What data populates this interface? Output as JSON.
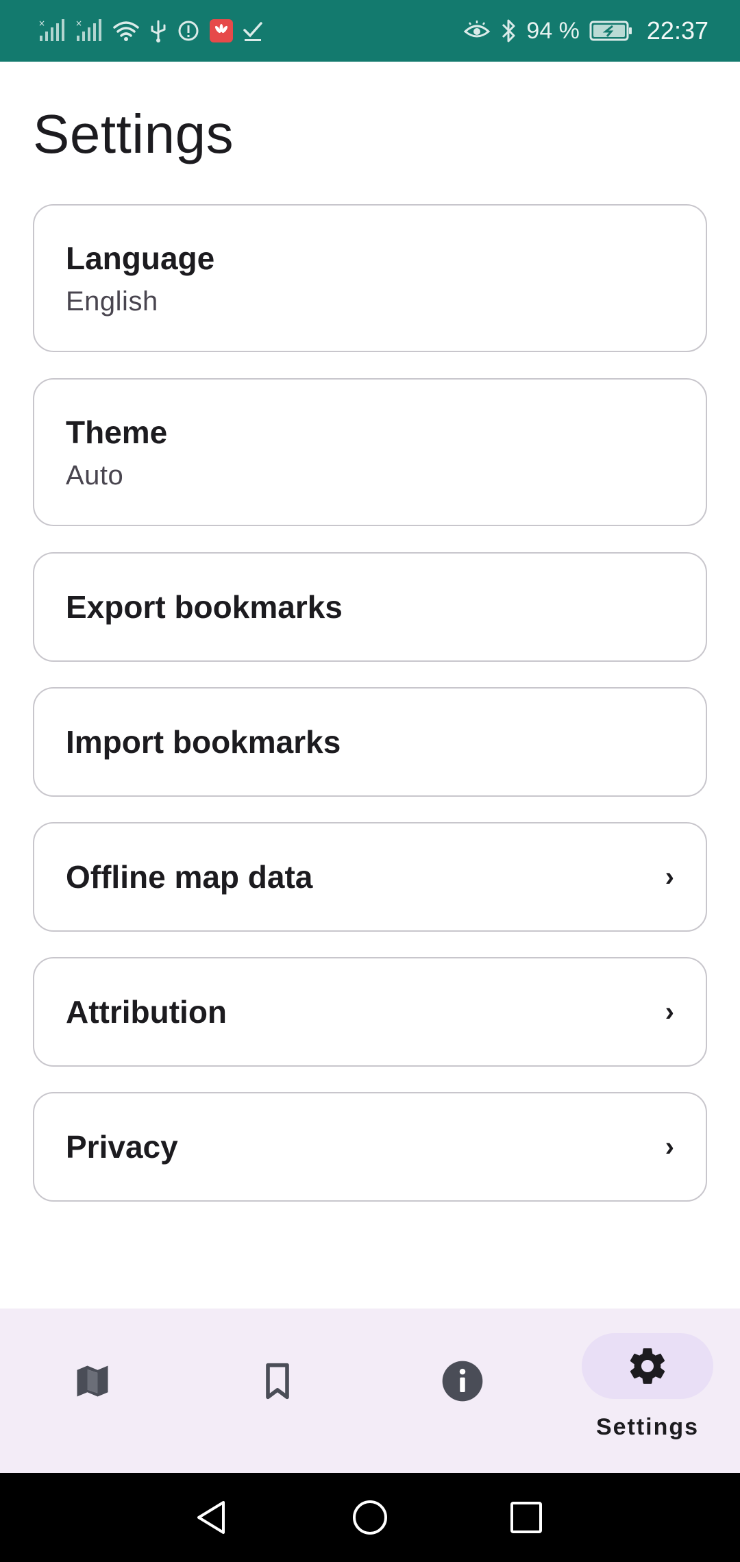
{
  "status_bar": {
    "battery": "94 %",
    "time": "22:37",
    "icons": [
      "signal-1-icon",
      "signal-2-icon",
      "wifi-icon",
      "usb-icon",
      "alert-icon",
      "huawei-app-icon",
      "check-icon",
      "eye-comfort-icon",
      "bluetooth-icon",
      "battery-charging-icon"
    ]
  },
  "page": {
    "title": "Settings"
  },
  "settings": {
    "language": {
      "title": "Language",
      "value": "English"
    },
    "theme": {
      "title": "Theme",
      "value": "Auto"
    },
    "export": {
      "title": "Export bookmarks"
    },
    "import": {
      "title": "Import bookmarks"
    },
    "offline": {
      "title": "Offline map data",
      "chevron": "›"
    },
    "attribution": {
      "title": "Attribution",
      "chevron": "›"
    },
    "privacy": {
      "title": "Privacy",
      "chevron": "›"
    }
  },
  "bottom_nav": {
    "items": [
      {
        "icon": "map-icon",
        "label": ""
      },
      {
        "icon": "bookmark-icon",
        "label": ""
      },
      {
        "icon": "info-icon",
        "label": ""
      },
      {
        "icon": "gear-icon",
        "label": "Settings",
        "active": true
      }
    ]
  },
  "system_nav": {
    "buttons": [
      "back-icon",
      "home-icon",
      "recents-icon"
    ]
  },
  "colors": {
    "status_bar": "#137a6e",
    "nav_background": "#f3ecf7",
    "nav_active_pill": "#e9dff6",
    "card_border": "#c8c6cc",
    "icon_dark": "#4a4d57"
  }
}
